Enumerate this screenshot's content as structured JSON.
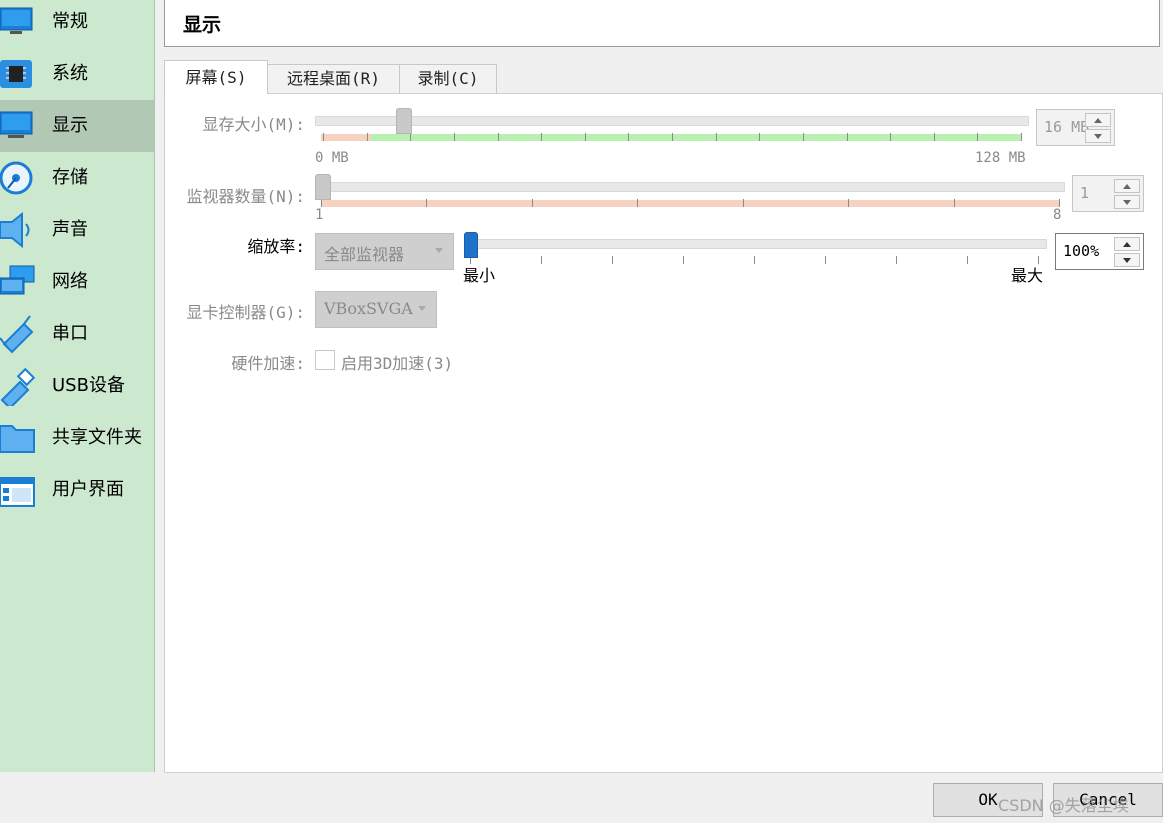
{
  "sidebar": {
    "items": [
      {
        "label": "常规",
        "icon": "general-monitor-icon"
      },
      {
        "label": "系统",
        "icon": "system-chip-icon"
      },
      {
        "label": "显示",
        "icon": "display-monitor-icon",
        "selected": true
      },
      {
        "label": "存储",
        "icon": "storage-disk-icon"
      },
      {
        "label": "声音",
        "icon": "audio-speaker-icon"
      },
      {
        "label": "网络",
        "icon": "network-icon"
      },
      {
        "label": "串口",
        "icon": "serial-port-icon"
      },
      {
        "label": "USB设备",
        "icon": "usb-icon"
      },
      {
        "label": "共享文件夹",
        "icon": "shared-folder-icon"
      },
      {
        "label": "用户界面",
        "icon": "user-interface-icon"
      }
    ]
  },
  "header": {
    "title": "显示"
  },
  "tabs": [
    {
      "label": "屏幕(S)",
      "active": true
    },
    {
      "label": "远程桌面(R)"
    },
    {
      "label": "录制(C)"
    }
  ],
  "screen": {
    "video_memory": {
      "label": "显存大小(M):",
      "value": "16 MB",
      "min_label": "0 MB",
      "max_label": "128 MB",
      "level": 0.125
    },
    "monitor_count": {
      "label": "监视器数量(N):",
      "value": "1",
      "min_label": "1",
      "max_label": "8",
      "level": 0
    },
    "scale_factor": {
      "label": "缩放率:",
      "combo_value": "全部监视器",
      "value": "100%",
      "min_label": "最小",
      "max_label": "最大",
      "level": 0
    },
    "graphics_controller": {
      "label": "显卡控制器(G):",
      "value": "VBoxSVGA"
    },
    "acceleration": {
      "label": "硬件加速:",
      "checkbox_label": "启用3D加速(3)",
      "checked": false
    }
  },
  "buttons": {
    "ok": "OK",
    "cancel": "Cancel"
  },
  "watermark": "CSDN @失落尘埃",
  "colors": {
    "sidebar_bg": "#cce8cf",
    "sidebar_selected": "#b1c8b4",
    "scale_green": "#b8f0b0",
    "scale_red": "#f8d2c0",
    "slider_accent": "#1e73c8"
  }
}
